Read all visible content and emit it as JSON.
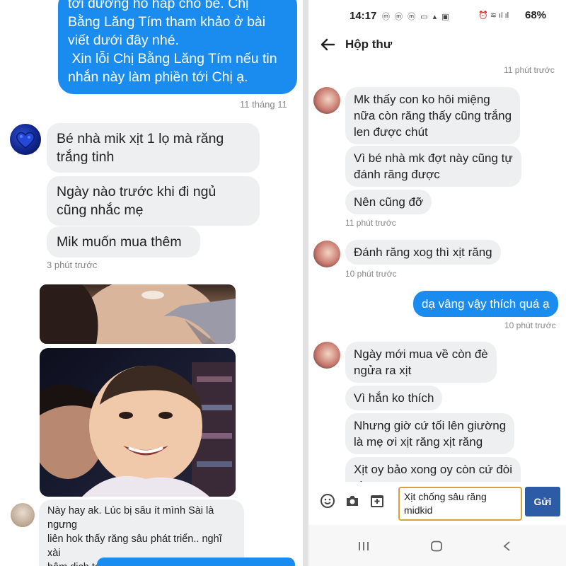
{
  "left": {
    "top_message_lines": [
      "tới dưỡng hô hấp cho bé. Chị",
      "Bằng Lăng Tím tham khảo ở bài",
      "viết dưới đây nhé.",
      " Xin lỗi Chị Bằng Lăng Tím nếu tin",
      "nhắn này làm phiền tới Chị ạ."
    ],
    "top_timestamp": "11 tháng 11",
    "messages": [
      "Bé nhà mik xịt 1 lọ mà răng\ntrắng tinh",
      "Ngày nào trước khi đi ngủ\ncũng nhắc mẹ",
      "Mik muốn mua thêm"
    ],
    "messages_time": "3 phút trước",
    "comment": "Này hay ak. Lúc bị sâu ít mình Sài là ngưng\nliên hok thấy răng sâu phát triển.. nghĩ xài\nhôm dịch tới h Bị sâu thấy rõ 😊"
  },
  "right": {
    "status": {
      "time": "14:17",
      "left_icons": "ⓜ ⓜ ⓜ ▭ ▴ ▣",
      "right_icons": "⏰ ≋ ıl ıl",
      "battery": "68%"
    },
    "title": "Hộp thư",
    "top_time": "11 phút trước",
    "group1": [
      "Mk thấy con ko hôi miệng\nnữa còn răng thấy cũng trắng\nlen được chút",
      "Vì bé nhà mk đợt này cũng tự\nđánh răng được",
      "Nên cũng đỡ"
    ],
    "group1_time": "11 phút trước",
    "group2": [
      "Đánh răng xog thì xịt răng"
    ],
    "group2_time": "10 phút trước",
    "sent": "dạ vâng vậy thích quá ạ",
    "sent_time": "10 phút trước",
    "group3": [
      "Ngày mới mua về còn đè\nngửa ra xịt",
      "Vì hắn ko thích",
      "Nhưng giờ cứ tối lên giường\nlà mẹ ơi xịt răng xịt răng",
      "Xịt oy bảo xong oy còn cứ đòi\nxịt"
    ],
    "composer_text": "Xịt chống sâu răng\nmidkid",
    "send_label": "Gửi"
  }
}
